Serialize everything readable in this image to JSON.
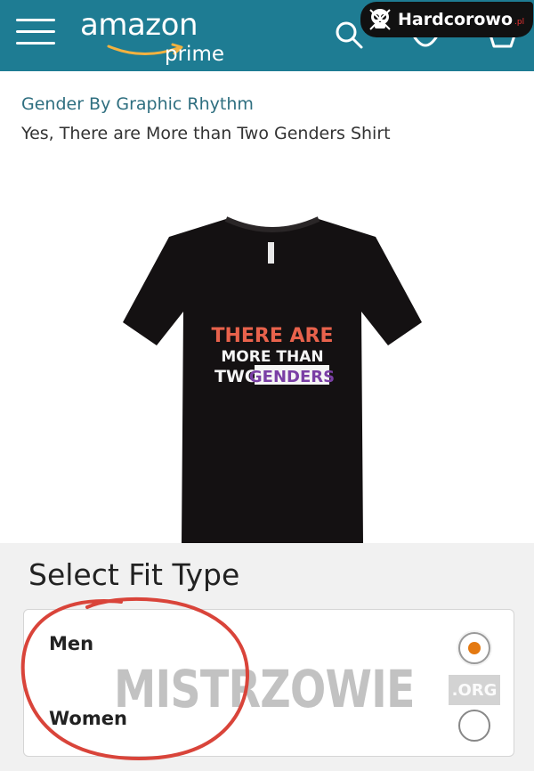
{
  "header": {
    "logo_text": "amazon",
    "logo_sub": "prime",
    "bg_color": "#1e7c93"
  },
  "watermark": {
    "site_name": "Hardcorowo",
    "site_tld": ".pl"
  },
  "product": {
    "brand": "Gender By Graphic Rhythm",
    "title": "Yes, There are More than Two Genders Shirt",
    "shirt_print": {
      "line1": "THERE ARE",
      "line2": "MORE THAN",
      "line3a": "TWO",
      "line3b": "GENDERS"
    },
    "shirt_color": "#141112"
  },
  "fit": {
    "title": "Select Fit Type",
    "options": [
      {
        "label": "Men",
        "selected": true
      },
      {
        "label": "Women",
        "selected": false
      }
    ],
    "accent_color": "#e47911"
  },
  "overlay": {
    "text": "MISTRZOWIE",
    "tld": ".ORG",
    "circle_color": "#d9443a"
  }
}
